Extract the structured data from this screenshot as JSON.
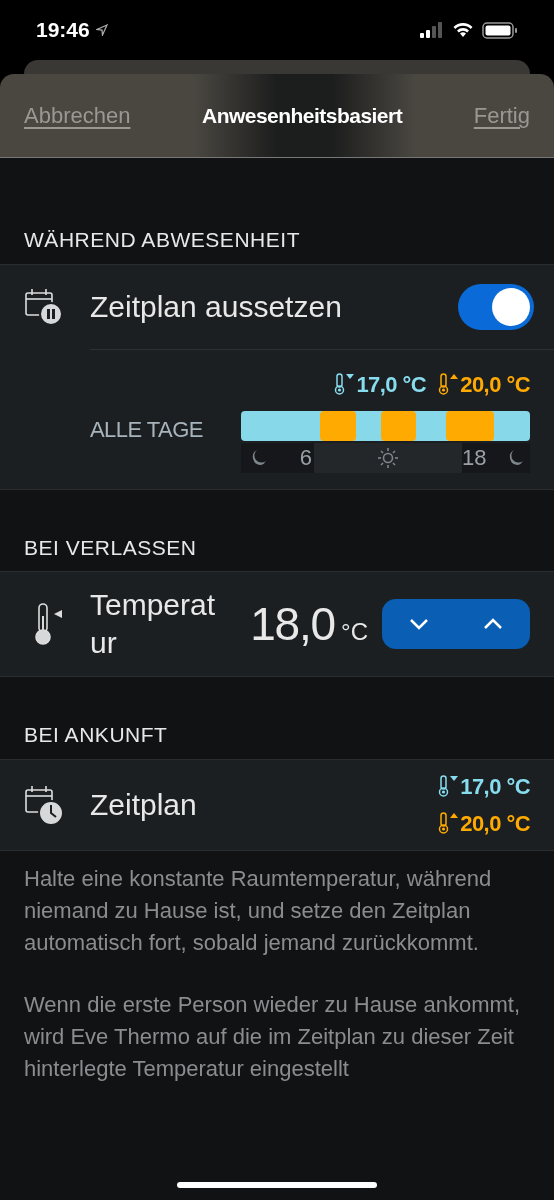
{
  "status_bar": {
    "time": "19:46"
  },
  "nav": {
    "cancel": "Abbrechen",
    "title": "Anwesenheitsbasiert",
    "done": "Fertig"
  },
  "sections": [
    {
      "header": "WÄHREND ABWESENHEIT",
      "kind": "schedule_toggle",
      "label": "Zeitplan aussetzen",
      "on": true,
      "temps": [
        {
          "kind": "low",
          "text": "17,0 °C"
        },
        {
          "kind": "high",
          "text": "20,0 °C"
        }
      ],
      "schedule": {
        "day_label": "ALLE TAGE",
        "ticks": [
          "6",
          "18"
        ]
      }
    },
    {
      "header": "BEI VERLASSEN",
      "kind": "temperature",
      "label": "Temperatur",
      "value": "18,0",
      "unit": "°C"
    },
    {
      "header": "BEI ANKUNFT",
      "kind": "schedule",
      "label": "Zeitplan",
      "temps": [
        {
          "kind": "low",
          "text": "17,0 °C"
        },
        {
          "kind": "high",
          "text": "20,0 °C"
        }
      ]
    }
  ],
  "footer": [
    "Halte eine konstante Raumtemperatur, während niemand zu Hause ist, und setze den Zeitplan automatisch fort, sobald jemand zurückkommt.",
    "Wenn die erste Person wieder zu Hause ankommt, wird Eve Thermo auf die im Zeitplan zu dieser Zeit hinterlegte Temperatur eingestellt"
  ]
}
